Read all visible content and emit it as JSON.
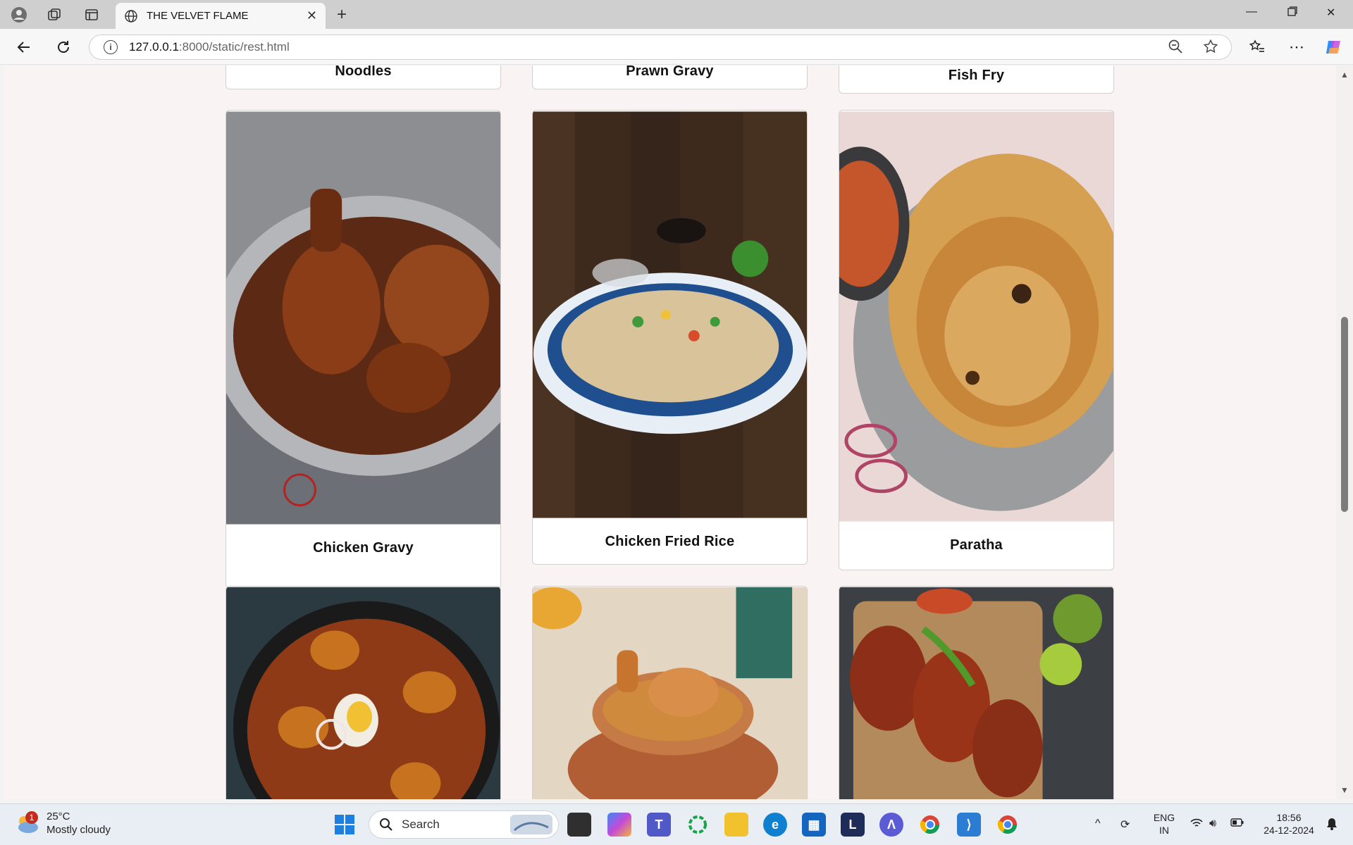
{
  "browser": {
    "tab_title": "THE VELVET FLAME",
    "url_host": "127.0.0.1",
    "url_path": ":8000/static/rest.html"
  },
  "menu": {
    "top_row": [
      "Noodles",
      "Prawn Gravy",
      "Fish Fry"
    ],
    "middle_row": [
      "Chicken Gravy",
      "Chicken Fried Rice",
      "Paratha"
    ]
  },
  "taskbar": {
    "temperature": "25°C",
    "weather": "Mostly cloudy",
    "weather_badge": "1",
    "search_label": "Search",
    "language_line1": "ENG",
    "language_line2": "IN",
    "time": "18:56",
    "date": "24-12-2024"
  },
  "colors": {
    "page_background": "#faf3f3",
    "accent_edge": "#0078d4"
  }
}
